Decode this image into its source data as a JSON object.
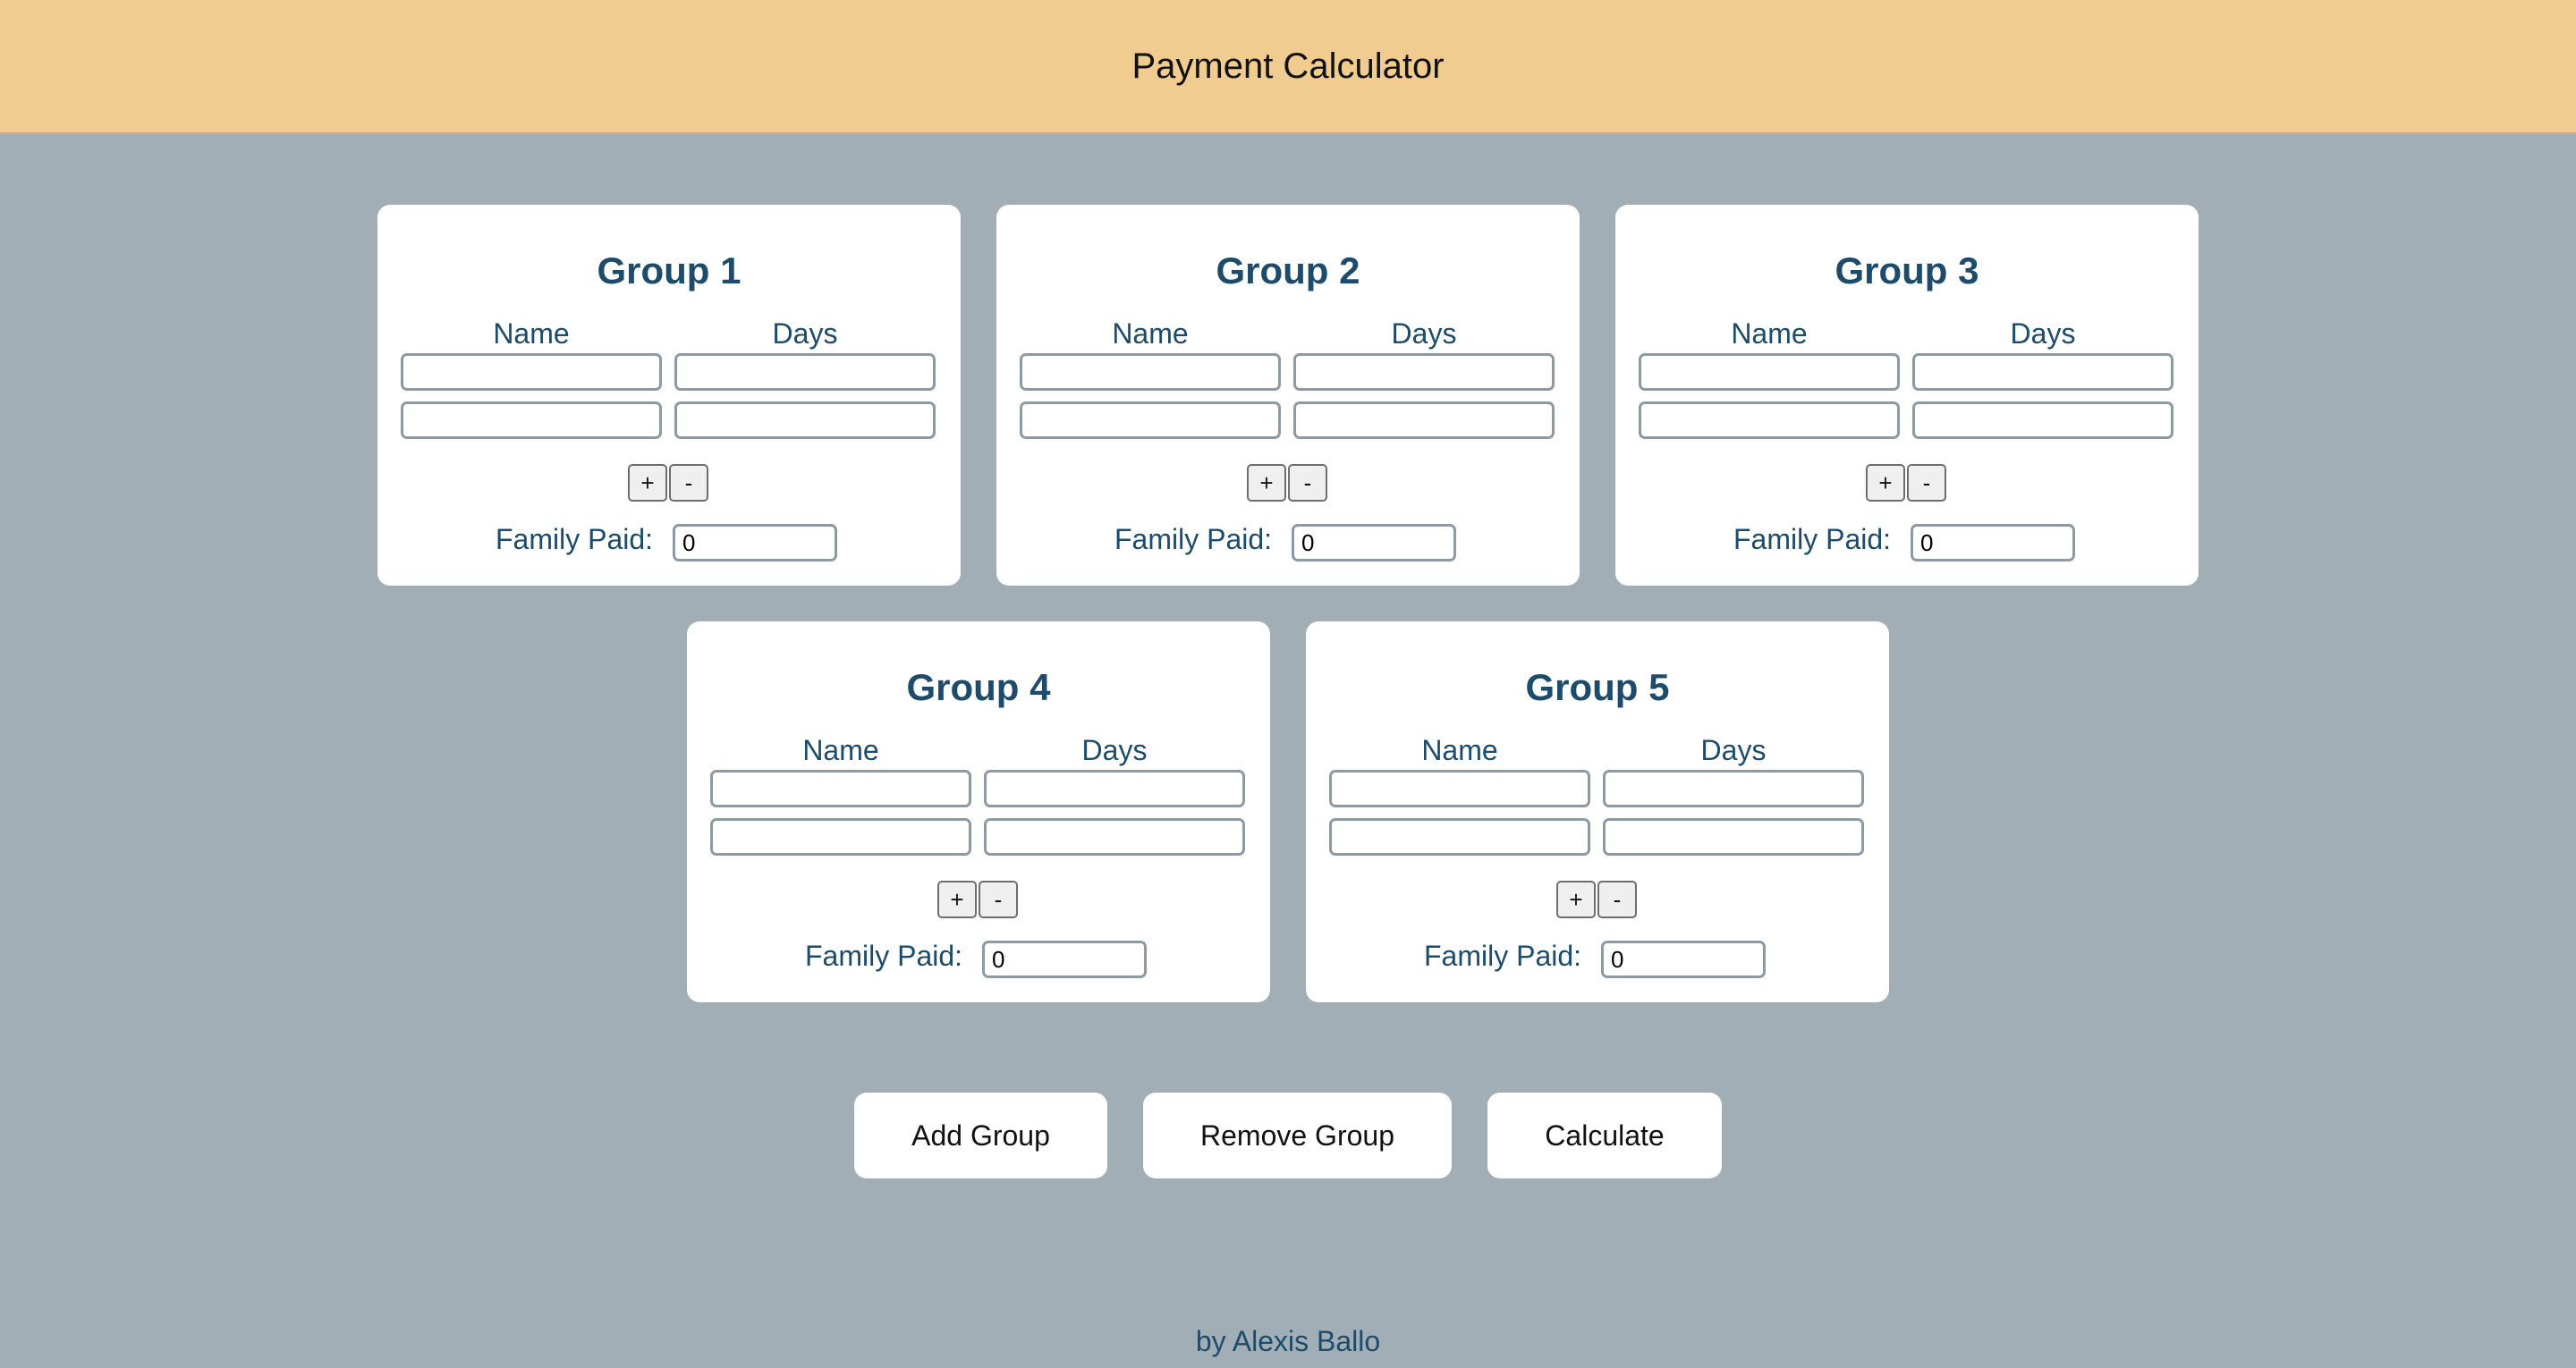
{
  "header": {
    "title": "Payment Calculator"
  },
  "columns": {
    "name": "Name",
    "days": "Days"
  },
  "row_controls": {
    "add": "+",
    "remove": "-"
  },
  "family_paid_label": "Family Paid:",
  "groups": [
    {
      "title": "Group 1",
      "family_paid": "0",
      "rows": [
        {
          "name": "",
          "days": ""
        },
        {
          "name": "",
          "days": ""
        }
      ]
    },
    {
      "title": "Group 2",
      "family_paid": "0",
      "rows": [
        {
          "name": "",
          "days": ""
        },
        {
          "name": "",
          "days": ""
        }
      ]
    },
    {
      "title": "Group 3",
      "family_paid": "0",
      "rows": [
        {
          "name": "",
          "days": ""
        },
        {
          "name": "",
          "days": ""
        }
      ]
    },
    {
      "title": "Group 4",
      "family_paid": "0",
      "rows": [
        {
          "name": "",
          "days": ""
        },
        {
          "name": "",
          "days": ""
        }
      ]
    },
    {
      "title": "Group 5",
      "family_paid": "0",
      "rows": [
        {
          "name": "",
          "days": ""
        },
        {
          "name": "",
          "days": ""
        }
      ]
    }
  ],
  "actions": {
    "add_group": "Add Group",
    "remove_group": "Remove Group",
    "calculate": "Calculate"
  },
  "footer": {
    "credit": "by Alexis Ballo"
  },
  "colors": {
    "header_bg": "#f0cc90",
    "page_bg": "#a1aeb5",
    "heading_text": "#1d4b6b",
    "card_bg": "#ffffff"
  }
}
